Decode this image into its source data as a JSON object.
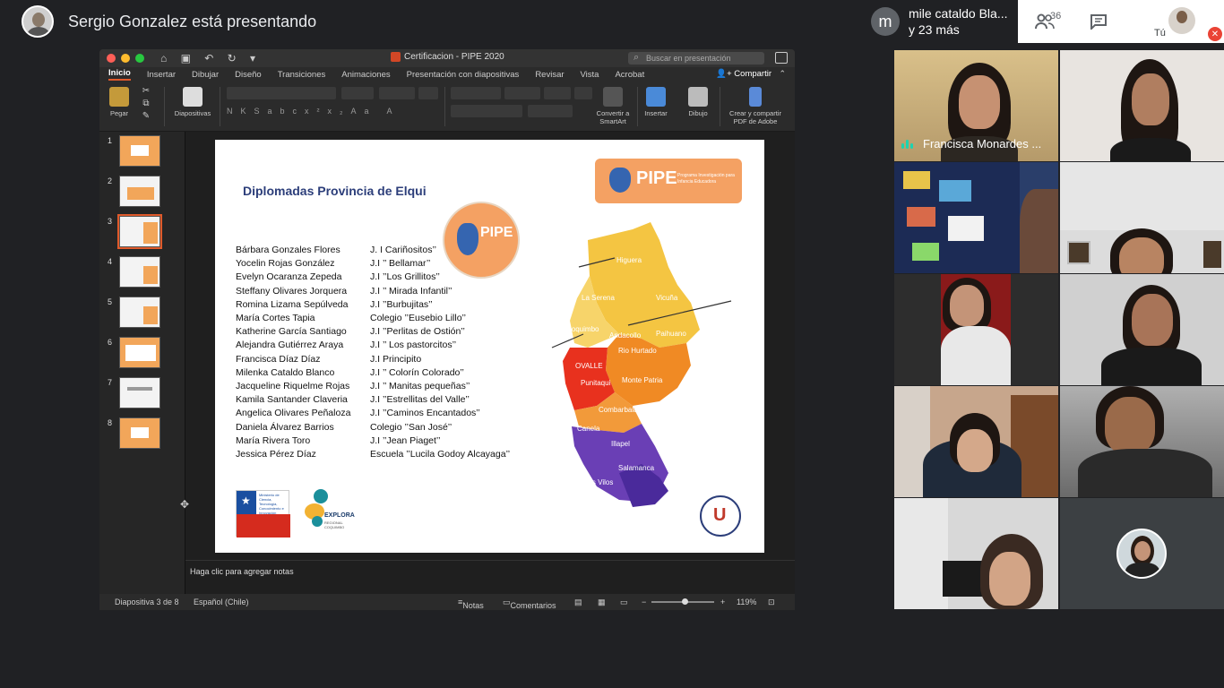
{
  "meet": {
    "presenting_text": "Sergio Gonzalez está presentando",
    "pinned": {
      "initial": "m",
      "line1": "mile cataldo Bla...",
      "line2": "y 23 más"
    },
    "participants_count": "36",
    "self_label": "Tú",
    "tiles": [
      {
        "name": "Francisca Monardes ..."
      }
    ]
  },
  "ppt": {
    "title": "Certificacion -  PIPE 2020",
    "search_placeholder": "Buscar en presentación",
    "tabs": [
      "Inicio",
      "Insertar",
      "Dibujar",
      "Diseño",
      "Transiciones",
      "Animaciones",
      "Presentación con diapositivas",
      "Revisar",
      "Vista",
      "Acrobat"
    ],
    "share_label": "Compartir",
    "ribbon": {
      "paste": "Pegar",
      "slides": "Diapositivas",
      "smartart": "Convertir a SmartArt",
      "insert": "Insertar",
      "draw": "Dibujo",
      "adobe": "Crear y compartir PDF de Adobe"
    },
    "thumb_numbers": [
      "1",
      "2",
      "3",
      "4",
      "5",
      "6",
      "7",
      "8"
    ],
    "notes_placeholder": "Haga clic para agregar notas",
    "status": {
      "slide_counter": "Diapositiva 3 de 8",
      "language": "Español (Chile)",
      "notes": "Notas",
      "comments": "Comentarios",
      "zoom": "119%"
    }
  },
  "slide": {
    "title": "Diplomadas Provincia de Elqui",
    "badge": "PIPE",
    "badge_sub": "Programa Investigación para Infancia Educadora",
    "names": [
      "Bárbara Gonzales Flores",
      "Yocelin Rojas González",
      "Evelyn Ocaranza Zepeda",
      "Steffany Olivares Jorquera",
      "Romina Lizama Sepúlveda",
      "María Cortes Tapia",
      "Katherine García Santiago",
      "Alejandra Gutiérrez Araya",
      "Francisca Díaz Díaz",
      "Milenka Cataldo Blanco",
      "Jacqueline Riquelme Rojas",
      "Kamila Santander Claveria",
      "Angelica Olivares Peñaloza",
      "Daniela Álvarez Barrios",
      "María Rivera Toro",
      "Jessica Pérez Díaz"
    ],
    "schools": [
      "J. I Cariñositos’’",
      "J.I ’’ Bellamar’’",
      "J.I ’’Los Grillitos’’",
      "J.I ’’ Mirada Infantil’’",
      "J.I ’’Burbujitas’’",
      "Colegio ’’Eusebio Lillo’’",
      "J.I ’’Perlitas de Ostión’’",
      "J.I ’’ Los pastorcitos’’",
      "J.I Principito",
      "J.I ’’ Colorín Colorado’’",
      "J.I ’’ Manitas pequeñas’’",
      "J.I ’’Estrellitas del Valle’’",
      "J.I ’’Caminos Encantados’’",
      "Colegio ’’San José’’",
      "J.I ’’Jean Piaget’’",
      "Escuela ’’Lucila Godoy Alcayaga’’"
    ],
    "map_labels": {
      "higuera": "Higuera",
      "la_serena": "La Serena",
      "vicuna": "Vicuña",
      "coquimbo": "Coquimbo",
      "andacollo": "Andacollo",
      "paihuano": "Paihuano",
      "rio_hurtado": "Rio Hurtado",
      "ovalle": "OVALLE",
      "punitaqui": "Punitaqui",
      "monte_patria": "Monte Patria",
      "combarbala": "Combarbalá",
      "canela": "Canela",
      "illapel": "Illapel",
      "salamanca": "Salamanca",
      "los_vilos": "Los Vilos"
    },
    "logos": {
      "gob_text": "Ministerio de Ciencia, Tecnología, Conocimiento e Innovación",
      "gob_sub": "Gobierno de Chile",
      "explora": "EXPLORA",
      "explora_sub": "REGIONAL COQUIMBO"
    }
  }
}
